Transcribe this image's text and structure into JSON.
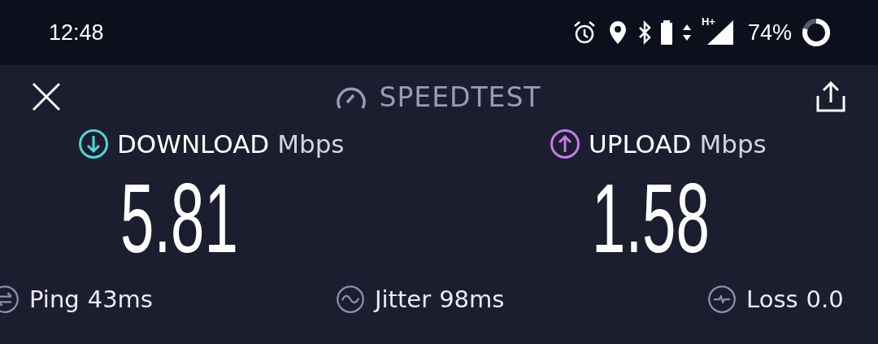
{
  "status_bar": {
    "time": "12:48",
    "network": "H+",
    "battery": "74%"
  },
  "header": {
    "title": "SPEEDTEST"
  },
  "results": [
    {
      "kind": "download",
      "label": "DOWNLOAD",
      "unit": "Mbps",
      "value": "5.81",
      "color": "#4fd6d6"
    },
    {
      "kind": "upload",
      "label": "UPLOAD",
      "unit": "Mbps",
      "value": "1.58",
      "color": "#c47be8"
    }
  ],
  "metrics": [
    {
      "kind": "ping",
      "label": "Ping",
      "value": "43ms"
    },
    {
      "kind": "jitter",
      "label": "Jitter",
      "value": "98ms"
    },
    {
      "kind": "loss",
      "label": "Loss",
      "value": "0.0"
    }
  ]
}
